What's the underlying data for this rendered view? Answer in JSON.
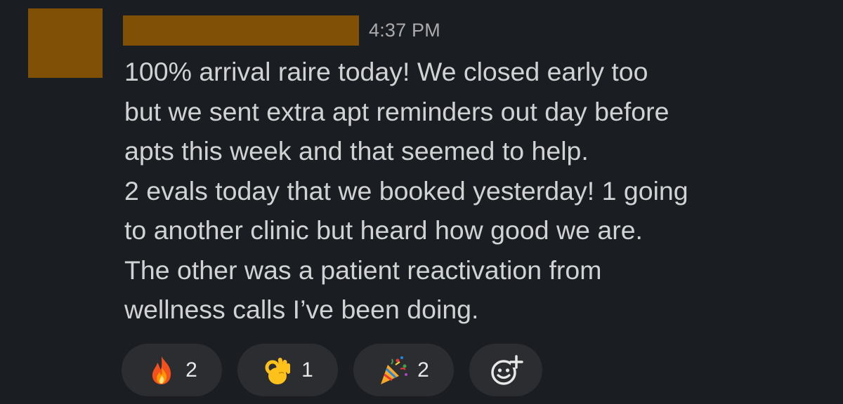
{
  "message": {
    "timestamp": "4:37 PM",
    "lines": [
      "100% arrival raire today! We closed early too",
      "but we sent extra apt reminders out day before",
      "apts this week and that seemed to help.",
      "2 evals today that we booked yesterday! 1 going",
      "to another clinic but heard how good we are.",
      "The other was a patient reactivation from",
      "wellness calls I’ve been doing."
    ]
  },
  "reactions": [
    {
      "icon": "fire-icon",
      "count": "2"
    },
    {
      "icon": "ok-hand-icon",
      "count": "1"
    },
    {
      "icon": "party-popper-icon",
      "count": "2"
    }
  ],
  "add_reaction": {
    "icon": "add-reaction-icon"
  },
  "colors": {
    "background": "#1a1d21",
    "redaction": "#7f5005",
    "pill": "#2c2d31",
    "text": "#d1d2d3",
    "muted": "#ababad"
  }
}
